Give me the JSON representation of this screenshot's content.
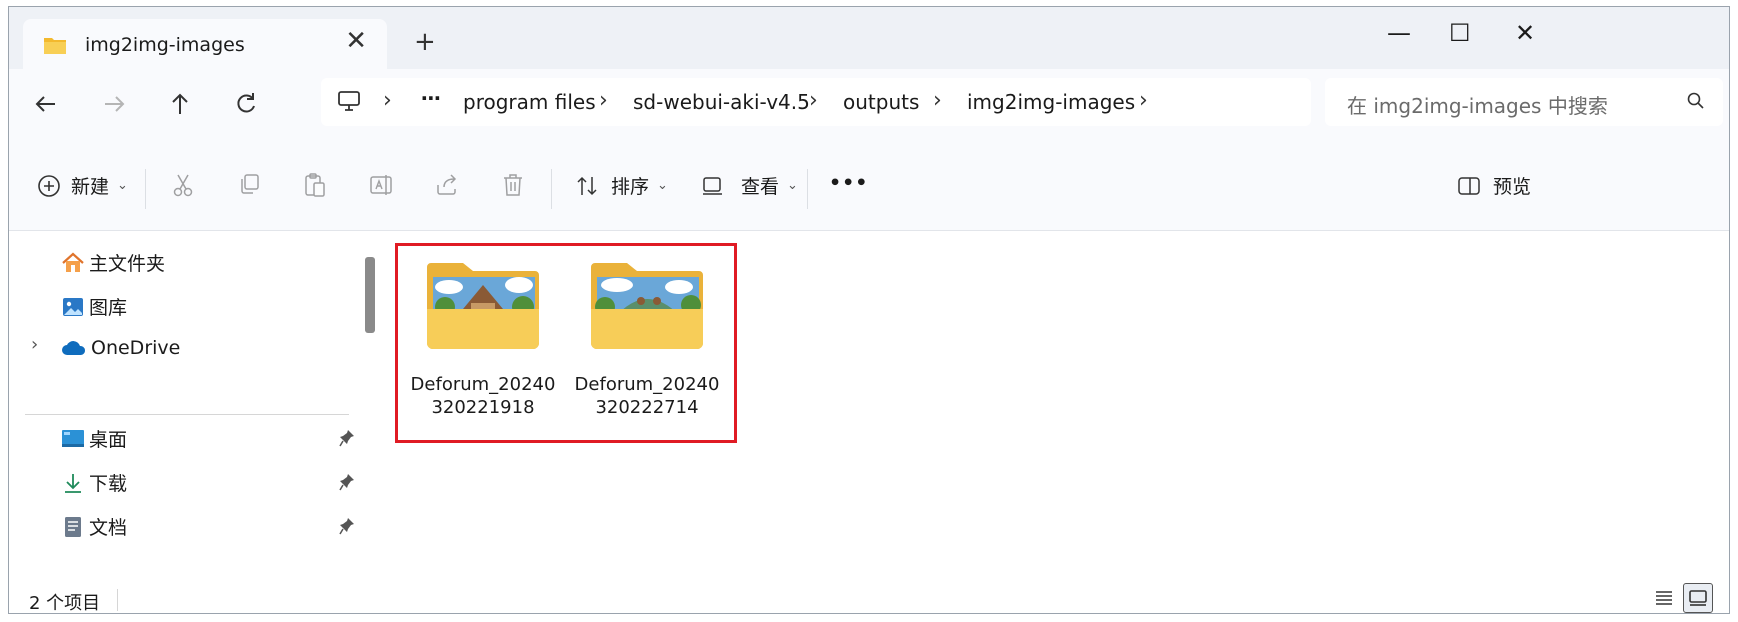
{
  "window": {
    "tab_title": "img2img-images",
    "tab_close": "✕",
    "new_tab": "+",
    "minimize": "—",
    "maximize": "☐",
    "close": "✕"
  },
  "address": {
    "overflow": "⋯",
    "breadcrumbs": [
      "program files",
      "sd-webui-aki-v4.5",
      "outputs",
      "img2img-images"
    ],
    "separator": "›",
    "search_placeholder": "在 img2img-images 中搜索"
  },
  "toolbar": {
    "new_label": "新建",
    "sort_label": "排序",
    "view_label": "查看",
    "more_label": "•••",
    "preview_label": "预览",
    "caret": "⌄"
  },
  "sidebar": {
    "items": [
      {
        "label": "主文件夹"
      },
      {
        "label": "图库"
      },
      {
        "label": "OneDrive"
      },
      {
        "label": "桌面"
      },
      {
        "label": "下载"
      },
      {
        "label": "文档"
      }
    ],
    "expand_chevron": "›"
  },
  "content": {
    "folders": [
      {
        "name": "Deforum_20240\n320221918"
      },
      {
        "name": "Deforum_20240\n320222714"
      }
    ]
  },
  "status": {
    "item_count": "2 个项目"
  },
  "colors": {
    "accent_highlight": "#e01b24",
    "folder_yellow": "#f6c54b",
    "onedrive_blue": "#0f6cbd"
  },
  "icons": [
    "folder-icon",
    "back-arrow-icon",
    "forward-arrow-icon",
    "up-arrow-icon",
    "refresh-icon",
    "computer-icon",
    "search-icon",
    "new-plus-icon",
    "cut-icon",
    "copy-icon",
    "paste-icon",
    "rename-icon",
    "share-icon",
    "delete-icon",
    "sort-icon",
    "view-icon",
    "preview-pane-icon",
    "home-icon",
    "gallery-icon",
    "cloud-icon",
    "desktop-icon",
    "download-icon",
    "document-icon",
    "pin-icon",
    "details-view-icon",
    "tiles-view-icon"
  ]
}
